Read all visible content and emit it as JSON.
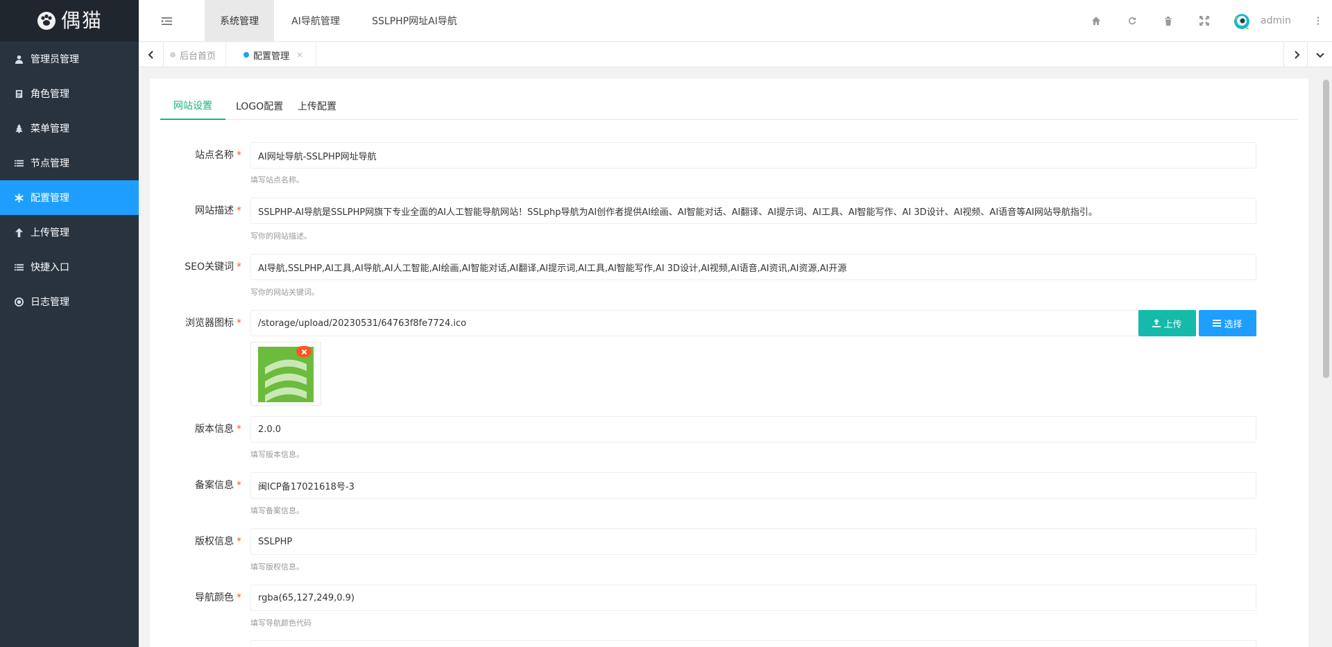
{
  "brand": {
    "logo_text": "偶猫"
  },
  "sidebar": {
    "items": [
      {
        "label": "管理员管理",
        "icon": "user-icon",
        "active": false
      },
      {
        "label": "角色管理",
        "icon": "id-card-icon",
        "active": false
      },
      {
        "label": "菜单管理",
        "icon": "tree-icon",
        "active": false
      },
      {
        "label": "节点管理",
        "icon": "list-icon",
        "active": false
      },
      {
        "label": "配置管理",
        "icon": "asterisk-icon",
        "active": true
      },
      {
        "label": "上传管理",
        "icon": "arrow-up-icon",
        "active": false
      },
      {
        "label": "快捷入口",
        "icon": "list-icon",
        "active": false
      },
      {
        "label": "日志管理",
        "icon": "gear-log-icon",
        "active": false
      }
    ]
  },
  "header": {
    "tabs": [
      {
        "label": "系统管理",
        "active": true
      },
      {
        "label": "AI导航管理",
        "active": false
      },
      {
        "label": "SSLPHP网址AI导航",
        "active": false
      }
    ],
    "right_icons": [
      "home-icon",
      "refresh-icon",
      "trash-icon",
      "fullscreen-icon"
    ],
    "username": "admin"
  },
  "page_tabs": [
    {
      "label": "后台首页",
      "active": false,
      "dot_color": "#d2d2d2"
    },
    {
      "label": "配置管理",
      "active": true,
      "dot_color": "#1e9fff",
      "closable": "×"
    }
  ],
  "form_tabs": [
    {
      "label": "网站设置",
      "active": true
    },
    {
      "label": "LOGO配置",
      "active": false
    },
    {
      "label": "上传配置",
      "active": false
    }
  ],
  "fields": {
    "site_name": {
      "label": "站点名称",
      "value": "AI网址导航-SSLPHP网址导航",
      "hint": "填写站点名称。"
    },
    "site_desc": {
      "label": "网站描述",
      "value": "SSLPHP-AI导航是SSLPHP网旗下专业全面的AI人工智能导航网站！SSLphp导航为AI创作者提供AI绘画、AI智能对话、AI翻译、AI提示词、AI工具、AI智能写作、AI 3D设计、AI视频、AI语音等AI网站导航指引。",
      "hint": "写你的网站描述。"
    },
    "seo_keywords": {
      "label": "SEO关键词",
      "value": "AI导航,SSLPHP,AI工具,AI导航,AI人工智能,AI绘画,AI智能对话,AI翻译,AI提示词,AI工具,AI智能写作,AI 3D设计,AI视频,AI语音,AI资讯,AI资源,AI开源",
      "hint": "写你的网站关键词。"
    },
    "favicon": {
      "label": "浏览器图标",
      "value": "/storage/upload/20230531/64763f8fe7724.ico",
      "upload_label": "上传",
      "select_label": "选择"
    },
    "version": {
      "label": "版本信息",
      "value": "2.0.0",
      "hint": "填写版本信息。"
    },
    "icp": {
      "label": "备案信息",
      "value": "闽ICP备17021618号-3",
      "hint": "填写备案信息。"
    },
    "copyright": {
      "label": "版权信息",
      "value": "SSLPHP",
      "hint": "填写版权信息。"
    },
    "nav_color": {
      "label": "导航颜色",
      "value": "rgba(65,127,249,0.9)",
      "hint": "填写导航颜色代码"
    }
  },
  "colors": {
    "sidebar_bg": "#28333e",
    "accent_blue": "#1e9fff",
    "accent_green": "#16b777",
    "upload_teal": "#16baaa",
    "required_red": "#ff5722"
  }
}
